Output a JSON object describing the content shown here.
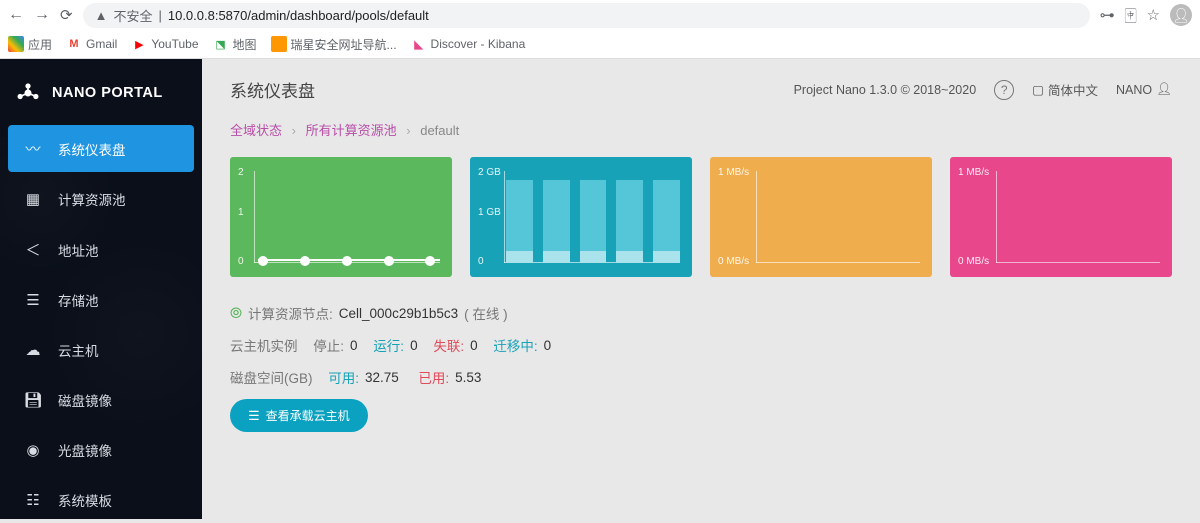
{
  "browser": {
    "insecure_label": "不安全",
    "url": "10.0.0.8:5870/admin/dashboard/pools/default",
    "bookmarks": {
      "apps": "应用",
      "gmail": "Gmail",
      "youtube": "YouTube",
      "maps": "地图",
      "ruixing": "瑞星安全网址导航...",
      "kibana": "Discover - Kibana"
    }
  },
  "sidebar": {
    "brand": "NANO PORTAL",
    "items": [
      {
        "label": "系统仪表盘"
      },
      {
        "label": "计算资源池"
      },
      {
        "label": "地址池"
      },
      {
        "label": "存储池"
      },
      {
        "label": "云主机"
      },
      {
        "label": "磁盘镜像"
      },
      {
        "label": "光盘镜像"
      },
      {
        "label": "系统模板"
      }
    ]
  },
  "header": {
    "title": "系统仪表盘",
    "project": "Project Nano 1.3.0 © 2018~2020",
    "lang": "简体中文",
    "user": "NANO"
  },
  "breadcrumb": {
    "a": "全域状态",
    "b": "所有计算资源池",
    "c": "default"
  },
  "info": {
    "node_label": "计算资源节点:",
    "node_name": "Cell_000c29b1b5c3",
    "node_status": "( 在线 )",
    "vm_instances": "云主机实例",
    "stopped_lbl": "停止:",
    "stopped": "0",
    "running_lbl": "运行:",
    "running": "0",
    "lost_lbl": "失联:",
    "lost": "0",
    "migrating_lbl": "迁移中:",
    "migrating": "0",
    "disk_label": "磁盘空间(GB)",
    "avail_lbl": "可用:",
    "avail": "32.75",
    "used_lbl": "已用:",
    "used": "5.53",
    "view_btn": "查看承载云主机"
  },
  "chart_data": [
    {
      "type": "line",
      "color": "#5cb85c",
      "ylim": [
        0,
        2
      ],
      "ticks": [
        "0",
        "1",
        "2"
      ],
      "x_count": 5,
      "values": [
        0,
        0,
        0,
        0,
        0
      ]
    },
    {
      "type": "bar",
      "color": "#17a2b8",
      "ylim": [
        0,
        2
      ],
      "ticks": [
        "0",
        "1 GB",
        "2 GB"
      ],
      "categories": [
        "",
        "",
        "",
        "",
        ""
      ],
      "values": [
        1.8,
        1.8,
        1.8,
        1.8,
        1.8
      ]
    },
    {
      "type": "line",
      "color": "#f0ad4e",
      "ylim": [
        0,
        1
      ],
      "ticks": [
        "0 MB/s",
        "1 MB/s"
      ],
      "x_count": 0,
      "values": []
    },
    {
      "type": "line",
      "color": "#e8478b",
      "ylim": [
        0,
        1
      ],
      "ticks": [
        "0 MB/s",
        "1 MB/s"
      ],
      "x_count": 0,
      "values": []
    }
  ]
}
